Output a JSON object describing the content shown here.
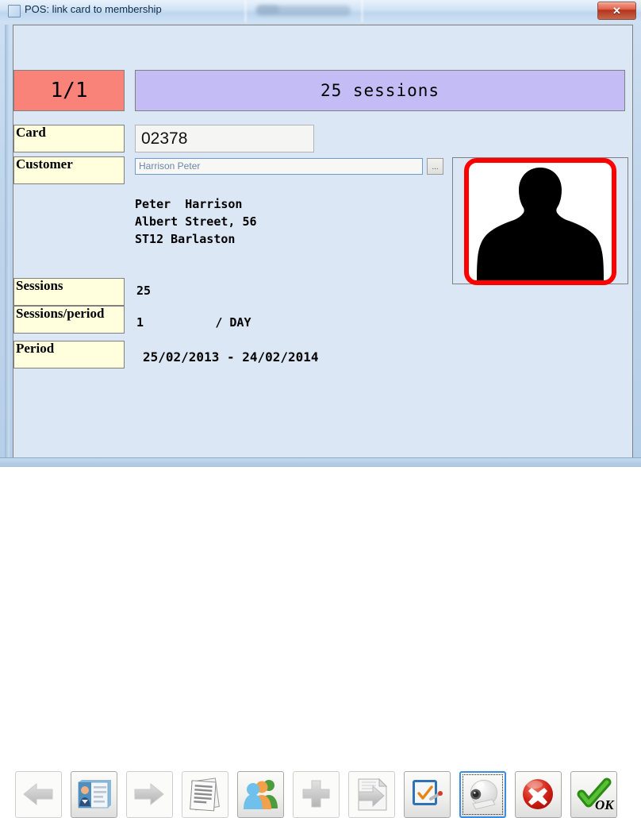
{
  "window": {
    "title": "POS: link card to membership",
    "icon": "window-icon",
    "close_label": "✕"
  },
  "form": {
    "counter": "1/1",
    "sessions_banner": "25 sessions",
    "card": {
      "label": "Card",
      "value": "02378"
    },
    "customer": {
      "label": "Customer",
      "value": "Harrison Peter",
      "browse_label": "..."
    },
    "address": "Peter  Harrison\nAlbert Street, 56\nST12 Barlaston",
    "sessions": {
      "label": "Sessions",
      "value": "25"
    },
    "sessions_per_period": {
      "label": "Sessions/period",
      "value": "1          / DAY"
    },
    "period": {
      "label": "Period",
      "value": "25/02/2013 - 24/02/2014"
    },
    "photo_alt": "person-silhouette"
  },
  "colors": {
    "counter_bg": "#fa8379",
    "banner_bg": "#c4bdf5",
    "label_bg": "#ffffdd",
    "client_bg": "#dce7f6",
    "photo_border": "#ff0000",
    "close_bg": "#c5402a"
  },
  "toolbar": {
    "buttons": [
      {
        "name": "previous-button",
        "icon": "arrow-left-icon",
        "state": "disabled"
      },
      {
        "name": "card-details-button",
        "icon": "id-card-icon",
        "state": "enabled"
      },
      {
        "name": "next-button",
        "icon": "arrow-right-icon",
        "state": "disabled"
      },
      {
        "name": "reports-button",
        "icon": "documents-icon",
        "state": "disabled"
      },
      {
        "name": "members-button",
        "icon": "people-group-icon",
        "state": "enabled"
      },
      {
        "name": "add-button",
        "icon": "plus-icon",
        "state": "disabled"
      },
      {
        "name": "export-button",
        "icon": "export-document-icon",
        "state": "disabled"
      },
      {
        "name": "signature-button",
        "icon": "checklist-tablet-icon",
        "state": "enabled"
      },
      {
        "name": "webcam-button",
        "icon": "webcam-icon",
        "state": "focused"
      },
      {
        "name": "cancel-button",
        "icon": "red-x-icon",
        "state": "enabled"
      },
      {
        "name": "ok-button",
        "icon": "green-check-ok-icon",
        "state": "enabled"
      }
    ]
  }
}
